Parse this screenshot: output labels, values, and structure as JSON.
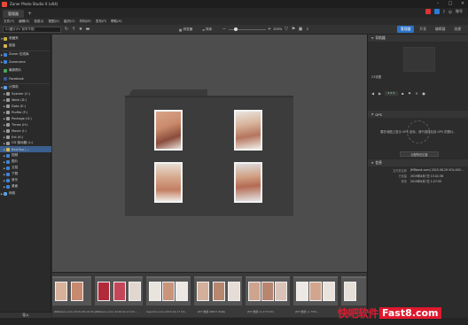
{
  "app": {
    "title": "Zoner Photo Studio X (x64)",
    "active_tab": "管理器",
    "account_label": "账号"
  },
  "menu": [
    "文件(F)",
    "编辑(E)",
    "信息(I)",
    "视图(V)",
    "组织(O)",
    "材料(M)",
    "发布(P)",
    "帮助(H)"
  ],
  "toolbar": {
    "address": "G:\\图片\\Yv´前车不熟\\",
    "view_label": "浏览器",
    "sort_label": "排序",
    "zoom": "100%",
    "modes": [
      "管理器",
      "开发",
      "编辑器",
      "创建"
    ]
  },
  "sidebar": {
    "items": [
      {
        "label": "收藏夹",
        "icon": "star-icon"
      },
      {
        "label": "链接",
        "icon": "folder-icon"
      },
      {
        "label": "Zoner 在线库",
        "icon": "cloud-icon"
      },
      {
        "label": "Zonerama",
        "icon": "zonerama-icon"
      },
      {
        "label": "最新照片",
        "icon": "clock-icon"
      },
      {
        "label": "Facebook",
        "icon": "facebook-icon"
      },
      {
        "label": "计算机",
        "icon": "computer-icon"
      },
      {
        "label": "System (C:)",
        "icon": "drive-icon"
      },
      {
        "label": "Work (D:)",
        "icon": "drive-icon"
      },
      {
        "label": "Data (E:)",
        "icon": "drive-icon"
      },
      {
        "label": "Profile (F:)",
        "icon": "drive-icon"
      },
      {
        "label": "Package (G:)",
        "icon": "drive-icon"
      },
      {
        "label": "Times (H:)",
        "icon": "drive-icon"
      },
      {
        "label": "Movie (I:)",
        "icon": "drive-icon"
      },
      {
        "label": "Ext (K:)",
        "icon": "drive-icon"
      },
      {
        "label": "CD 驱动器 (L:)",
        "icon": "disc-icon"
      },
      {
        "label": "BestTop (...",
        "icon": "folder-icon"
      },
      {
        "label": "视频",
        "icon": "video-icon"
      },
      {
        "label": "图片",
        "icon": "pictures-icon"
      },
      {
        "label": "文档",
        "icon": "documents-icon"
      },
      {
        "label": "下载",
        "icon": "download-icon"
      },
      {
        "label": "音乐",
        "icon": "music-icon"
      },
      {
        "label": "桌面",
        "icon": "desktop-icon"
      },
      {
        "label": "网络",
        "icon": "network-icon"
      }
    ],
    "import_label": "导入"
  },
  "right_panel": {
    "navigator_title": "导航器",
    "preview_caption": "23张图",
    "gps_title": "GPS",
    "gps_message": "要在地图上显示 GPS 坐标，请只选择包含 GPS 的照片。",
    "location_button": "分配所在位置",
    "info_title": "信息",
    "info": [
      {
        "label": "文件夹名称",
        "value": "JMRbank.com) 2015.08.29 VOL.000..."
      },
      {
        "label": "已创建",
        "value": "2019年8月7日 13:41:38"
      },
      {
        "label": "修改",
        "value": "2019年8月7日 1:27:55"
      }
    ]
  },
  "filmstrip": {
    "captions": [
      "JMRbank.com) 2015.08.29 VO...",
      "JMRbank.com) 2016.02.14 VO...",
      "Yegirlsh.com) 2015.04.17 VO...",
      "JMT 数据 (BEST WAN)",
      "JMT 数据 (2.277134)",
      "JMT 数据 (1.75M..."
    ]
  },
  "watermark": {
    "cn": "快吧软件",
    "en": "Fast8.com"
  },
  "colors": {
    "accent": "#2c72c7",
    "selection": "#3b5f8e",
    "watermark": "#e0192e"
  }
}
